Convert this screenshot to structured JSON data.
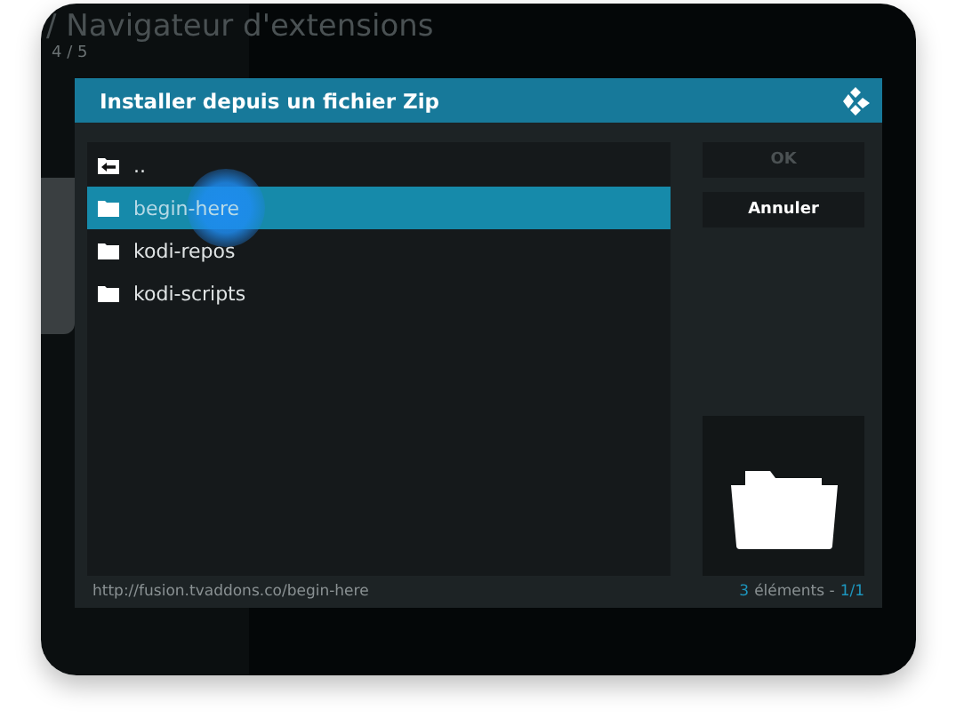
{
  "background": {
    "title": "/ Navigateur d'extensions",
    "subtitle": "4 / 5"
  },
  "dialog": {
    "title": "Installer depuis un fichier Zip",
    "items": [
      {
        "label": "..",
        "kind": "parent",
        "selected": false
      },
      {
        "label": "begin-here",
        "kind": "folder",
        "selected": true
      },
      {
        "label": "kodi-repos",
        "kind": "folder",
        "selected": false
      },
      {
        "label": "kodi-scripts",
        "kind": "folder",
        "selected": false
      }
    ],
    "buttons": [
      {
        "label": "OK",
        "disabled": true
      },
      {
        "label": "Annuler",
        "disabled": false
      }
    ],
    "path": "http://fusion.tvaddons.co/begin-here",
    "count": "3",
    "count_label": "éléments -",
    "page": "1/1"
  }
}
